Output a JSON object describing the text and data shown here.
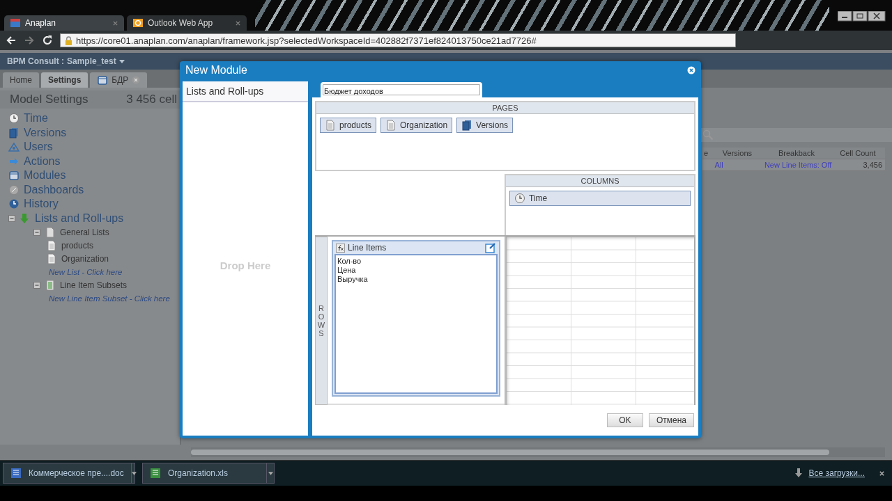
{
  "browser": {
    "tabs": [
      {
        "title": "Anaplan",
        "selected": true
      },
      {
        "title": "Outlook Web App",
        "selected": false
      }
    ],
    "url": "https://core01.anaplan.com/anaplan/framework.jsp?selectedWorkspaceId=402882f7371ef824013750ce21ad7726#"
  },
  "app": {
    "workspace": "BPM Consult :",
    "model": "Sample_test",
    "tabs": [
      {
        "label": "Home",
        "selected": false,
        "kind": "page"
      },
      {
        "label": "Settings",
        "selected": true,
        "kind": "page"
      },
      {
        "label": "БДР",
        "selected": false,
        "kind": "module"
      }
    ]
  },
  "model_settings": {
    "title": "Model Settings",
    "cells": "3 456 cell",
    "tree": [
      {
        "label": "Time",
        "kind": "time"
      },
      {
        "label": "Versions",
        "kind": "versions"
      },
      {
        "label": "Users",
        "kind": "users"
      },
      {
        "label": "Actions",
        "kind": "actions"
      },
      {
        "label": "Modules",
        "kind": "modules"
      },
      {
        "label": "Dashboards",
        "kind": "dashboards"
      },
      {
        "label": "History",
        "kind": "history"
      },
      {
        "label": "Lists and Roll-ups",
        "kind": "lists",
        "expanded": true,
        "children": [
          {
            "label": "General Lists",
            "kind": "folder",
            "expanded": true,
            "children": [
              {
                "label": "products",
                "kind": "list"
              },
              {
                "label": "Organization",
                "kind": "list"
              },
              {
                "label": "New List - Click here",
                "kind": "link"
              }
            ]
          },
          {
            "label": "Line Item Subsets",
            "kind": "subset",
            "expanded": true,
            "children": [
              {
                "label": "New Line Item Subset - Click here",
                "kind": "link"
              }
            ]
          }
        ]
      }
    ]
  },
  "background_table": {
    "columns": [
      "e",
      "Versions",
      "Breakback",
      "Cell Count"
    ],
    "rows": [
      {
        "versions": "All",
        "breakback": "New Line Items: Off",
        "cell_count": "3,456"
      }
    ]
  },
  "dialog": {
    "title": "New Module",
    "left_header": "Lists and Roll-ups",
    "drop_hint": "Drop Here",
    "name": "Бюджет доходов",
    "pages": {
      "title": "PAGES",
      "items": [
        {
          "label": "products",
          "kind": "list"
        },
        {
          "label": "Organization",
          "kind": "list"
        },
        {
          "label": "Versions",
          "kind": "versions"
        }
      ]
    },
    "columns": {
      "title": "COLUMNS",
      "items": [
        {
          "label": "Time",
          "kind": "time"
        }
      ]
    },
    "rows": {
      "title": "ROWS",
      "items": [
        {
          "label": "Line Items",
          "entries": [
            "Кол-во",
            "Цена",
            "Выручка"
          ]
        }
      ]
    },
    "buttons": [
      "OK",
      "Отмена"
    ]
  },
  "downloads": {
    "files": [
      {
        "name": "Коммерческое пре....doc",
        "kind": "doc"
      },
      {
        "name": "Organization.xls",
        "kind": "xls"
      }
    ],
    "show_all": "Все загрузки..."
  }
}
